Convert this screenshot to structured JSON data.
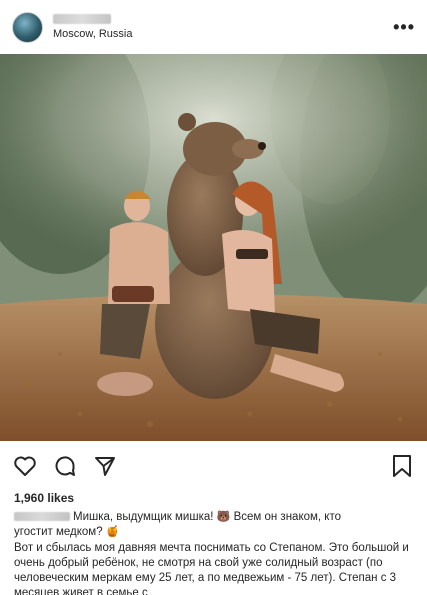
{
  "header": {
    "username": "nina_bearit",
    "location": "Moscow, Russia",
    "more_glyph": "•••"
  },
  "photo": {
    "description_icon": "photo-image"
  },
  "actions": {
    "like_icon": "heart-icon",
    "comment_icon": "comment-icon",
    "share_icon": "share-icon",
    "save_icon": "bookmark-icon"
  },
  "likes": "1,960 likes",
  "caption": {
    "username": "nina_bearit",
    "line1_a": "Мишка, выдумщик мишка!",
    "emoji1": "🐻",
    "line1_b": "Всем он знаком, кто",
    "line2": "угостит медком?",
    "emoji2": "🍯"
  },
  "description": "Вот и сбылась моя давняя мечта поснимать со Степаном. Это большой и очень добрый ребёнок, не смотря на свой уже солидный возраст (по человеческим меркам ему 25 лет, а по медвежьим - 75 лет). Степан с 3 месяцев живет в семье с",
  "colors": {
    "text": "#262626",
    "background": "#ffffff"
  }
}
